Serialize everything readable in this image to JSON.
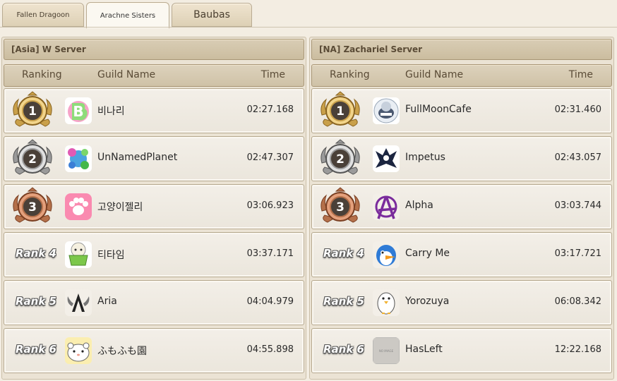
{
  "tabs": [
    {
      "label": "Fallen Dragoon",
      "active": false
    },
    {
      "label": "Arachne Sisters",
      "active": true
    },
    {
      "label": "Baubas",
      "active": false
    }
  ],
  "headers": {
    "ranking": "Ranking",
    "guild": "Guild Name",
    "time": "Time"
  },
  "servers": [
    {
      "title": "[Asia] W Server",
      "rows": [
        {
          "medal": "1",
          "rank_label": "",
          "guild": "비나리",
          "time": "02:27.168",
          "emblem": "b-logo-icon"
        },
        {
          "medal": "2",
          "rank_label": "",
          "guild": "UnNamedPlanet",
          "time": "02:47.307",
          "emblem": "planet-flowers-icon"
        },
        {
          "medal": "3",
          "rank_label": "",
          "guild": "고양이젤리",
          "time": "03:06.923",
          "emblem": "paw-icon"
        },
        {
          "medal": "",
          "rank_label": "Rank 4",
          "guild": "티타임",
          "time": "03:37.171",
          "emblem": "teacup-sheep-icon"
        },
        {
          "medal": "",
          "rank_label": "Rank 5",
          "guild": "Aria",
          "time": "04:04.979",
          "emblem": "winged-a-icon"
        },
        {
          "medal": "",
          "rank_label": "Rank 6",
          "guild": "ふもふも園",
          "time": "04:55.898",
          "emblem": "hamster-icon"
        }
      ]
    },
    {
      "title": "[NA] Zachariel Server",
      "rows": [
        {
          "medal": "1",
          "rank_label": "",
          "guild": "FullMoonCafe",
          "time": "02:31.460",
          "emblem": "moon-cat-icon"
        },
        {
          "medal": "2",
          "rank_label": "",
          "guild": "Impetus",
          "time": "02:43.057",
          "emblem": "phoenix-icon"
        },
        {
          "medal": "3",
          "rank_label": "",
          "guild": "Alpha",
          "time": "03:03.744",
          "emblem": "anarchy-a-icon"
        },
        {
          "medal": "",
          "rank_label": "Rank 4",
          "guild": "Carry Me",
          "time": "03:17.721",
          "emblem": "penguin-bird-icon"
        },
        {
          "medal": "",
          "rank_label": "Rank 5",
          "guild": "Yorozuya",
          "time": "06:08.342",
          "emblem": "penguin-icon"
        },
        {
          "medal": "",
          "rank_label": "Rank 6",
          "guild": "HasLeft",
          "time": "12:22.168",
          "emblem": "no-image-icon"
        }
      ]
    }
  ],
  "colors": {
    "gold": "#c9a04a",
    "silver": "#9a9a9a",
    "bronze": "#b4704a"
  }
}
